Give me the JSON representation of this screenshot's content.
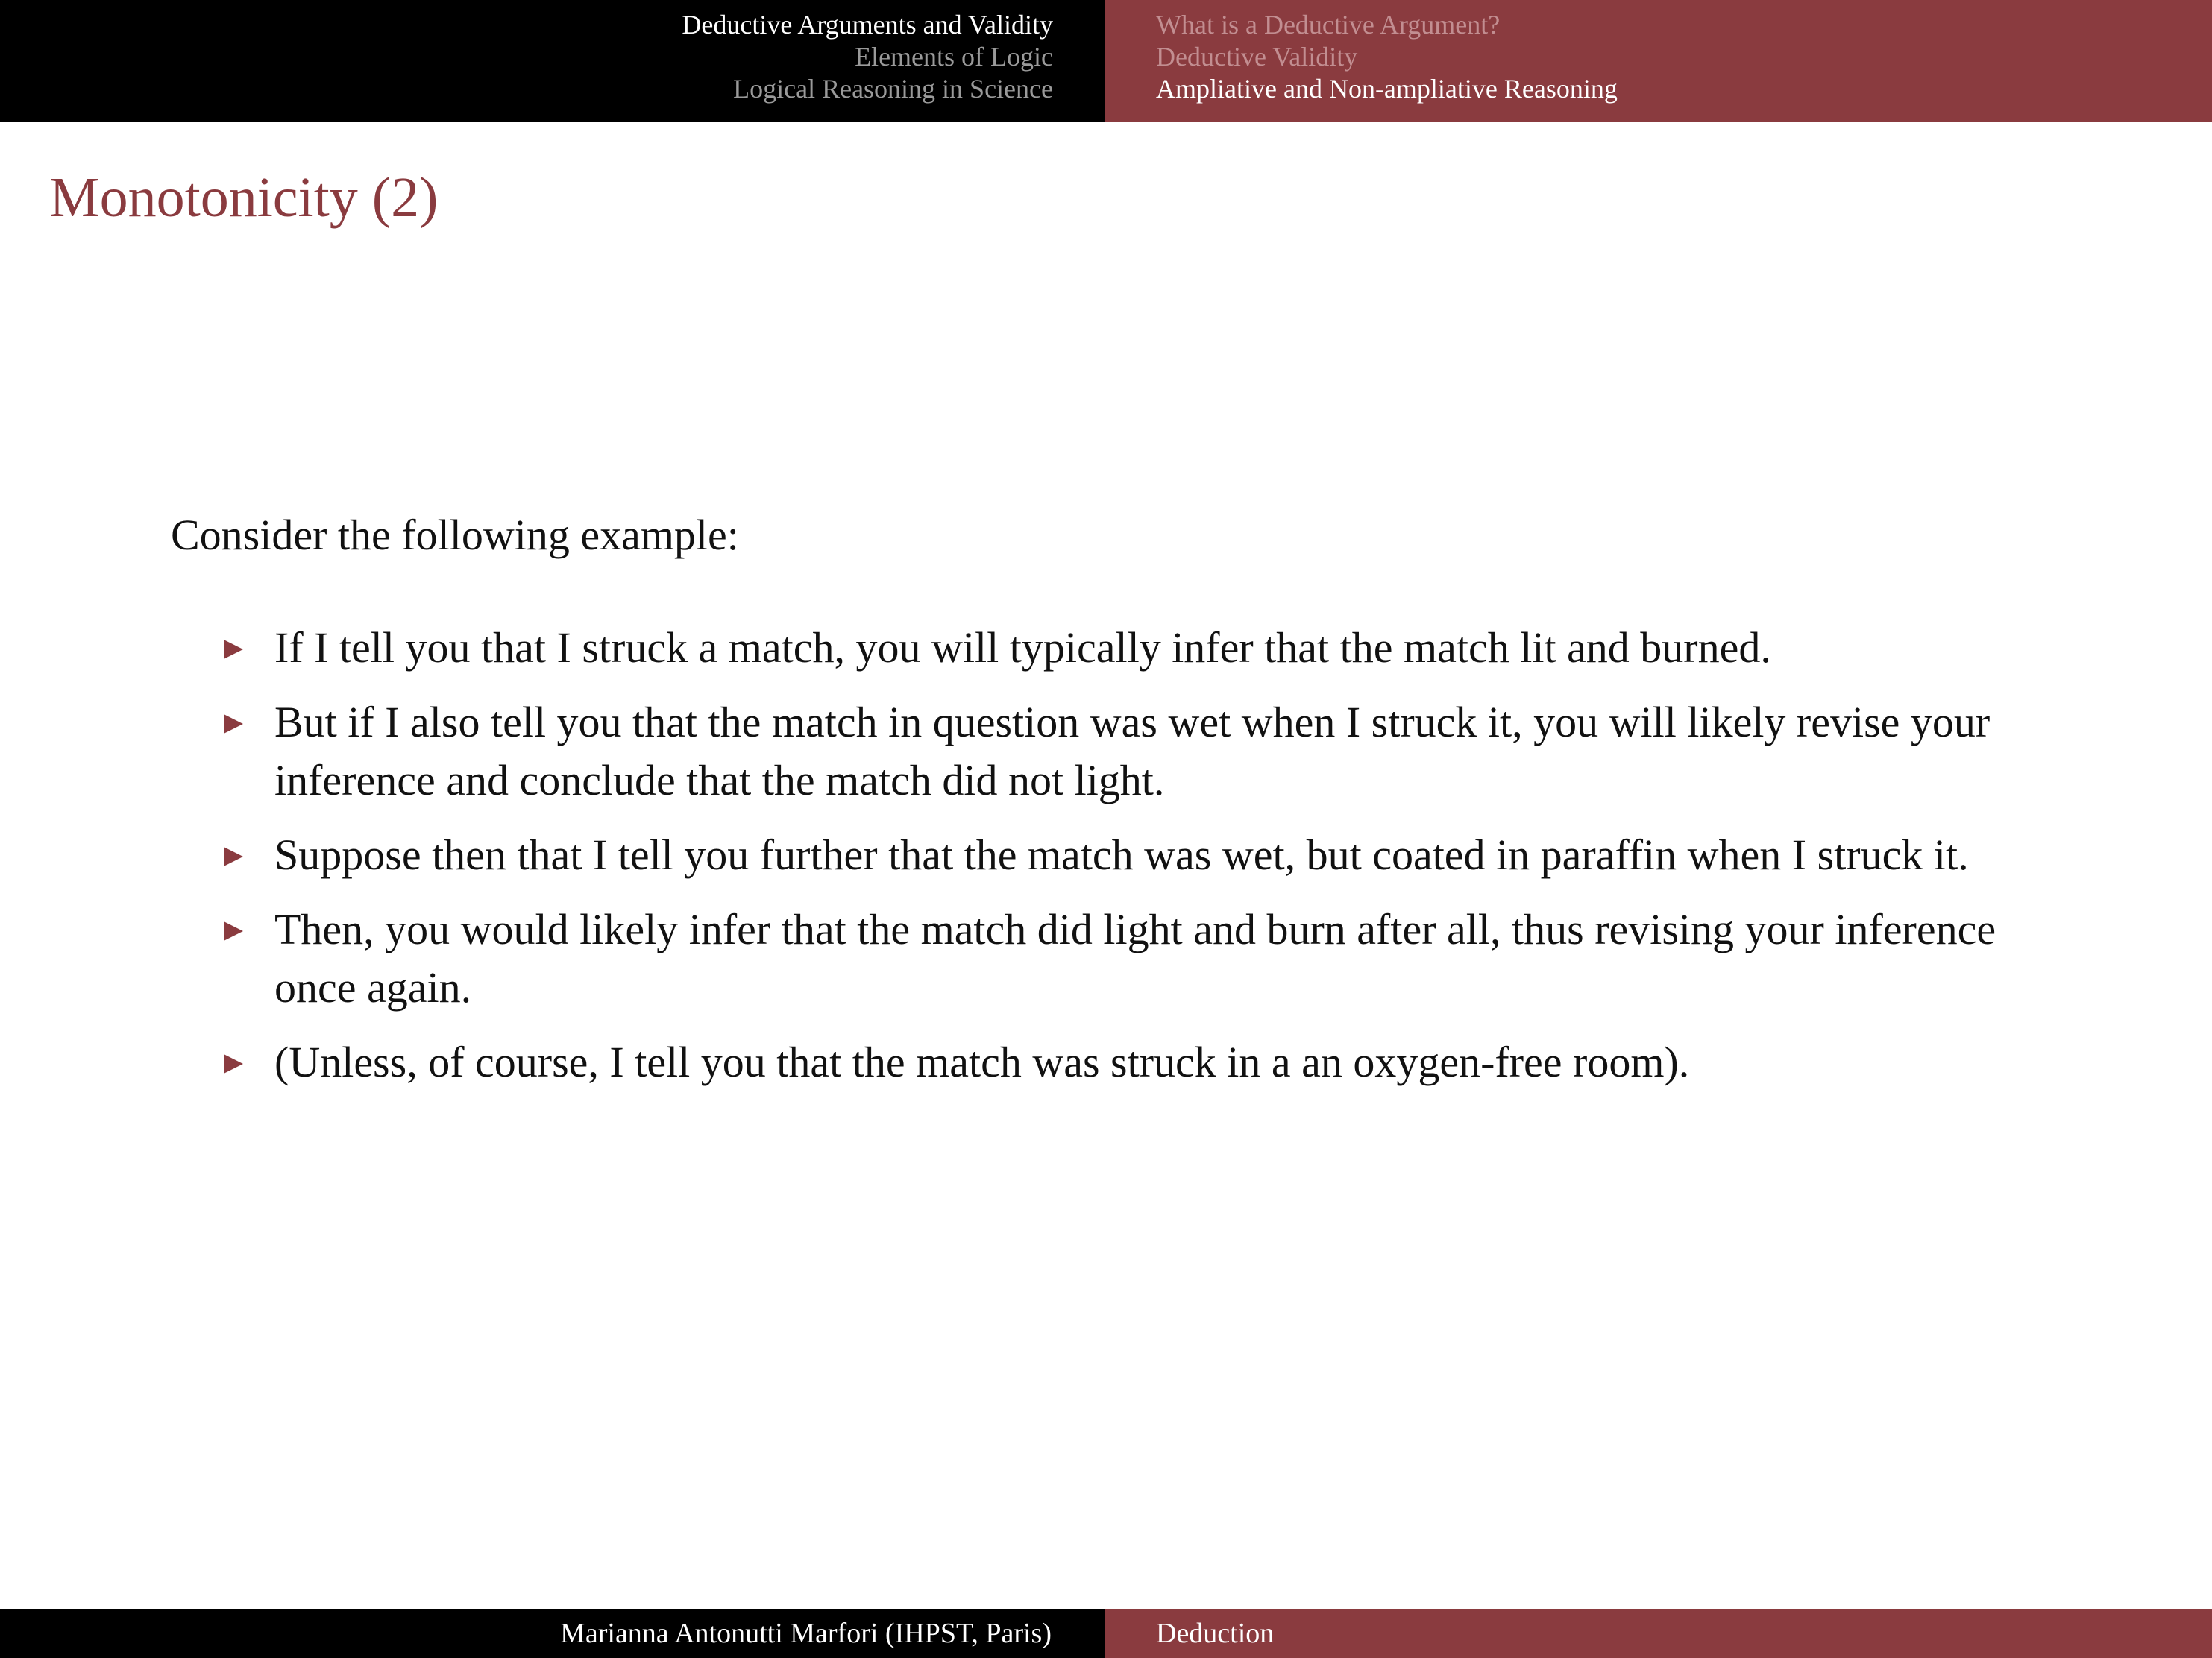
{
  "headline": {
    "sections": [
      {
        "label": "Deductive Arguments and Validity",
        "current": true
      },
      {
        "label": "Elements of Logic",
        "current": false
      },
      {
        "label": "Logical Reasoning in Science",
        "current": false
      }
    ],
    "subsections": [
      {
        "label": "What is a Deductive Argument?",
        "current": false
      },
      {
        "label": "Deductive Validity",
        "current": false
      },
      {
        "label": "Ampliative and Non-ampliative Reasoning",
        "current": true
      }
    ]
  },
  "slide": {
    "title": "Monotonicity (2)",
    "intro": "Consider the following example:",
    "bullets": [
      "If I tell you that I struck a match, you will typically infer that the match lit and burned.",
      "But if I also tell you that the match in question was wet when I struck it, you will likely revise your inference and conclude that the match did not light.",
      "Suppose then that I tell you further that the match was wet, but coated in paraffin when I struck it.",
      "Then, you would likely infer that the match did light and burn after all, thus revising your inference once again.",
      "(Unless, of course, I tell you that the match was struck in a an oxygen-free room)."
    ]
  },
  "footline": {
    "author": "Marianna Antonutti Marfori (IHPST, Paris)",
    "short_title": "Deduction"
  },
  "colors": {
    "accent": "#8a3b3f",
    "header_dark": "#000000",
    "text": "#111111"
  },
  "icons": {
    "bullet": "triangle-right-icon"
  }
}
